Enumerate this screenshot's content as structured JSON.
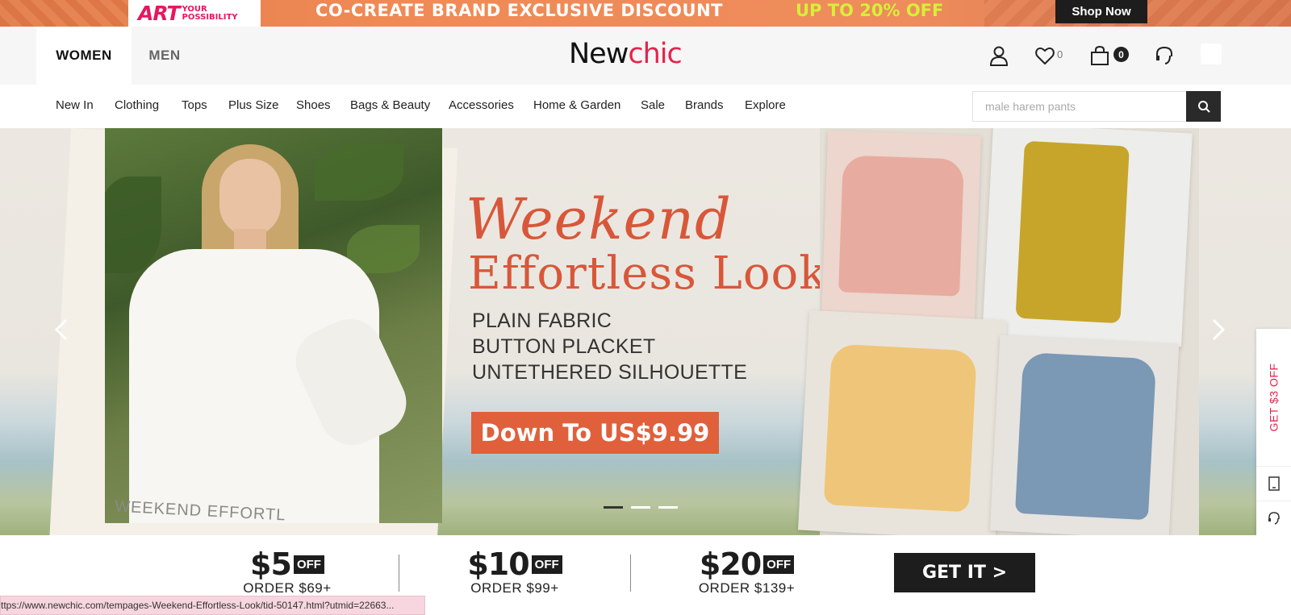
{
  "promo": {
    "logo_art": "ART",
    "logo_your": "YOUR",
    "logo_possibility": "POSSIBILITY",
    "headline": "CO-CREATE BRAND EXCLUSIVE DISCOUNT",
    "discount": "UP TO 20% OFF",
    "cta": "Shop Now"
  },
  "header": {
    "tabs": [
      {
        "label": "WOMEN",
        "active": true
      },
      {
        "label": "MEN",
        "active": false
      }
    ],
    "logo_new": "New",
    "logo_chic": "chic",
    "wishlist_count": "0",
    "cart_count": "0"
  },
  "nav": {
    "items": [
      "New In",
      "Clothing",
      "Tops",
      "Plus Size",
      "Shoes",
      "Bags & Beauty",
      "Accessories",
      "Home & Garden",
      "Sale",
      "Brands",
      "Explore"
    ],
    "search_placeholder": "male harem pants"
  },
  "hero": {
    "title_line1": "Weekend",
    "title_line2": "Effortless Look",
    "features": [
      "PLAIN FABRIC",
      "BUTTON PLACKET",
      "UNTETHERED SILHOUETTE"
    ],
    "cta": "Down To US$9.99",
    "photo_caption": "WEEKEND EFFORTL",
    "slides_total": 3,
    "active_slide": 1
  },
  "side_rail": {
    "coupon_label": "GET $3 OFF"
  },
  "coupons": [
    {
      "amount": "$5",
      "off": "OFF",
      "condition": "ORDER $69+"
    },
    {
      "amount": "$10",
      "off": "OFF",
      "condition": "ORDER $99+"
    },
    {
      "amount": "$20",
      "off": "OFF",
      "condition": "ORDER $139+"
    }
  ],
  "coupon_cta": "GET IT >",
  "status_bar": {
    "url": "ttps://www.newchic.com/tempages-Weekend-Effortless-Look/tid-50147.html?utmid=22663..."
  },
  "colors": {
    "brand_red": "#e5234c",
    "accent_orange": "#d8573a",
    "dark": "#1d1d1d"
  }
}
